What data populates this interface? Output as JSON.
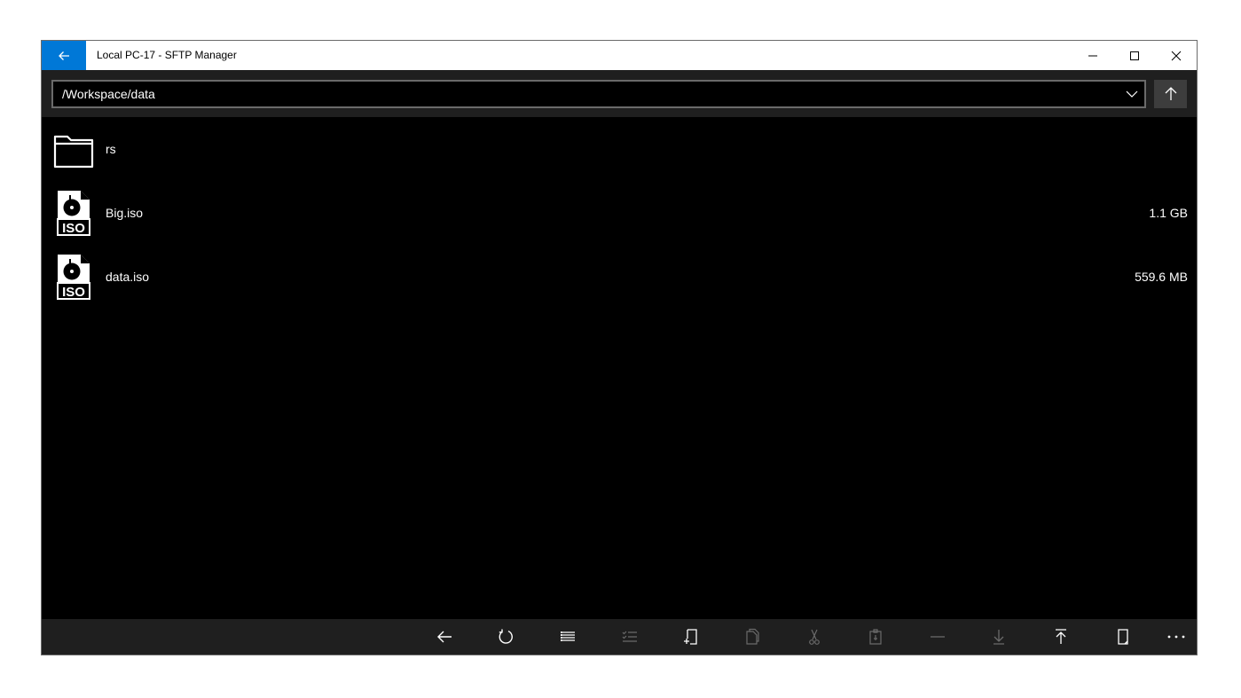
{
  "window": {
    "title": "Local PC-17 - SFTP Manager",
    "accent_color": "#0078d7"
  },
  "titlebar": {
    "back_icon": "back-arrow-icon",
    "controls": [
      "minimize-icon",
      "maximize-icon",
      "close-icon"
    ]
  },
  "address": {
    "path": "/Workspace/data",
    "dropdown_icon": "chevron-down-icon",
    "up_icon": "arrow-up-icon"
  },
  "files": [
    {
      "name": "rs",
      "type": "folder",
      "size": "",
      "icon": "folder-icon"
    },
    {
      "name": "Big.iso",
      "type": "iso",
      "size": "1.1 GB",
      "icon": "iso-file-icon",
      "badge": "ISO"
    },
    {
      "name": "data.iso",
      "type": "iso",
      "size": "559.6 MB",
      "icon": "iso-file-icon",
      "badge": "ISO"
    }
  ],
  "commands": [
    {
      "name": "back",
      "icon": "back-arrow-icon",
      "enabled": true
    },
    {
      "name": "refresh",
      "icon": "refresh-icon",
      "enabled": true
    },
    {
      "name": "list-view",
      "icon": "list-icon",
      "enabled": true
    },
    {
      "name": "select",
      "icon": "multi-select-icon",
      "enabled": false
    },
    {
      "name": "new-file",
      "icon": "new-file-icon",
      "enabled": true
    },
    {
      "name": "copy",
      "icon": "copy-icon",
      "enabled": false
    },
    {
      "name": "cut",
      "icon": "cut-icon",
      "enabled": false
    },
    {
      "name": "paste",
      "icon": "paste-icon",
      "enabled": false
    },
    {
      "name": "remove",
      "icon": "minus-icon",
      "enabled": false
    },
    {
      "name": "download",
      "icon": "download-icon",
      "enabled": false
    },
    {
      "name": "upload",
      "icon": "upload-icon",
      "enabled": true
    },
    {
      "name": "new-page",
      "icon": "page-icon",
      "enabled": true
    },
    {
      "name": "more",
      "icon": "more-icon",
      "enabled": true
    }
  ],
  "colors": {
    "command_enabled": "#ffffff",
    "command_disabled": "#6a6a6a"
  }
}
